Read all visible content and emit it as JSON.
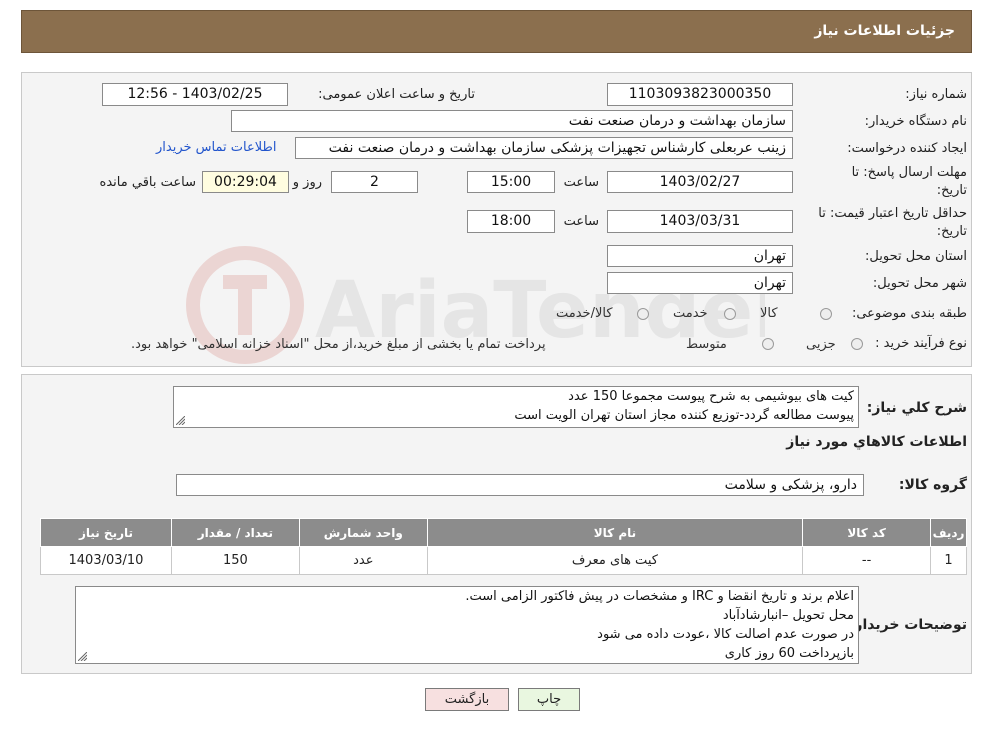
{
  "header": {
    "title": "جزئیات اطلاعات نیاز"
  },
  "form": {
    "need_number": {
      "label": "شماره نیاز:",
      "value": "1103093823000350"
    },
    "announce_datetime": {
      "label": "تاریخ و ساعت اعلان عمومی:",
      "value": "1403/02/25 - 12:56"
    },
    "buyer_org": {
      "label": "نام دستگاه خریدار:",
      "value": "سازمان بهداشت و درمان صنعت نفت"
    },
    "requester": {
      "label": "ایجاد کننده درخواست:",
      "value": "زینب عربعلی کارشناس تجهیزات پزشکی سازمان بهداشت و درمان صنعت نفت",
      "contact_link": "اطلاعات تماس خریدار"
    },
    "reply_deadline": {
      "label_line1": "مهلت ارسال پاسخ: تا",
      "label_line2": "تاریخ:",
      "date": "1403/02/27",
      "time_label": "ساعت",
      "time": "15:00",
      "days": "2",
      "days_label": "روز و",
      "remaining": "00:29:04",
      "remaining_label": "ساعت باقي مانده"
    },
    "price_validity": {
      "label_line1": "حداقل تاریخ اعتبار قیمت: تا",
      "label_line2": "تاریخ:",
      "date": "1403/03/31",
      "time_label": "ساعت",
      "time": "18:00"
    },
    "province": {
      "label": "استان محل تحویل:",
      "value": "تهران"
    },
    "city": {
      "label": "شهر محل تحویل:",
      "value": "تهران"
    },
    "category": {
      "label": "طبقه بندی موضوعی:",
      "options": [
        "کالا",
        "خدمت",
        "کالا/خدمت"
      ]
    },
    "purchase_type": {
      "label": "نوع فرآیند خرید :",
      "options": [
        "جزیی",
        "متوسط"
      ],
      "note": "پرداخت تمام یا بخشی از مبلغ خرید،از محل \"اسناد خزانه اسلامی\" خواهد بود."
    }
  },
  "watermark": {
    "text": "AriaTender.neT"
  },
  "description": {
    "label": "شرح کلي نياز:",
    "lines": [
      "کیت های بیوشیمی  به شرح پیوست مجموعا 150 عدد",
      "پیوست مطالعه گردد-توزیع کننده مجاز استان تهران الویت است"
    ]
  },
  "goods": {
    "section_title": "اطلاعات کالاهاي مورد نياز",
    "group_label": "گروه کالا:",
    "group_value": "دارو، پزشکی و سلامت",
    "table": {
      "headers": [
        "رديف",
        "کد کالا",
        "نام کالا",
        "واحد شمارش",
        "تعداد / مقدار",
        "تاریخ نیاز"
      ],
      "rows": [
        [
          "1",
          "--",
          "کیت های معرف",
          "عدد",
          "150",
          "1403/03/10"
        ]
      ]
    }
  },
  "buyer_notes": {
    "label": "توضیحات خریدار:",
    "lines": [
      "اعلام برند و تاریخ انقضا  و IRC  و مشخصات  در پیش فاکتور الزامی است.",
      "محل تحویل –انبارشادآباد",
      "در صورت عدم اصالت کالا ،عودت داده می شود",
      "بازپرداخت 60 روز کاری"
    ]
  },
  "buttons": {
    "print": "چاپ",
    "back": "بازگشت"
  }
}
